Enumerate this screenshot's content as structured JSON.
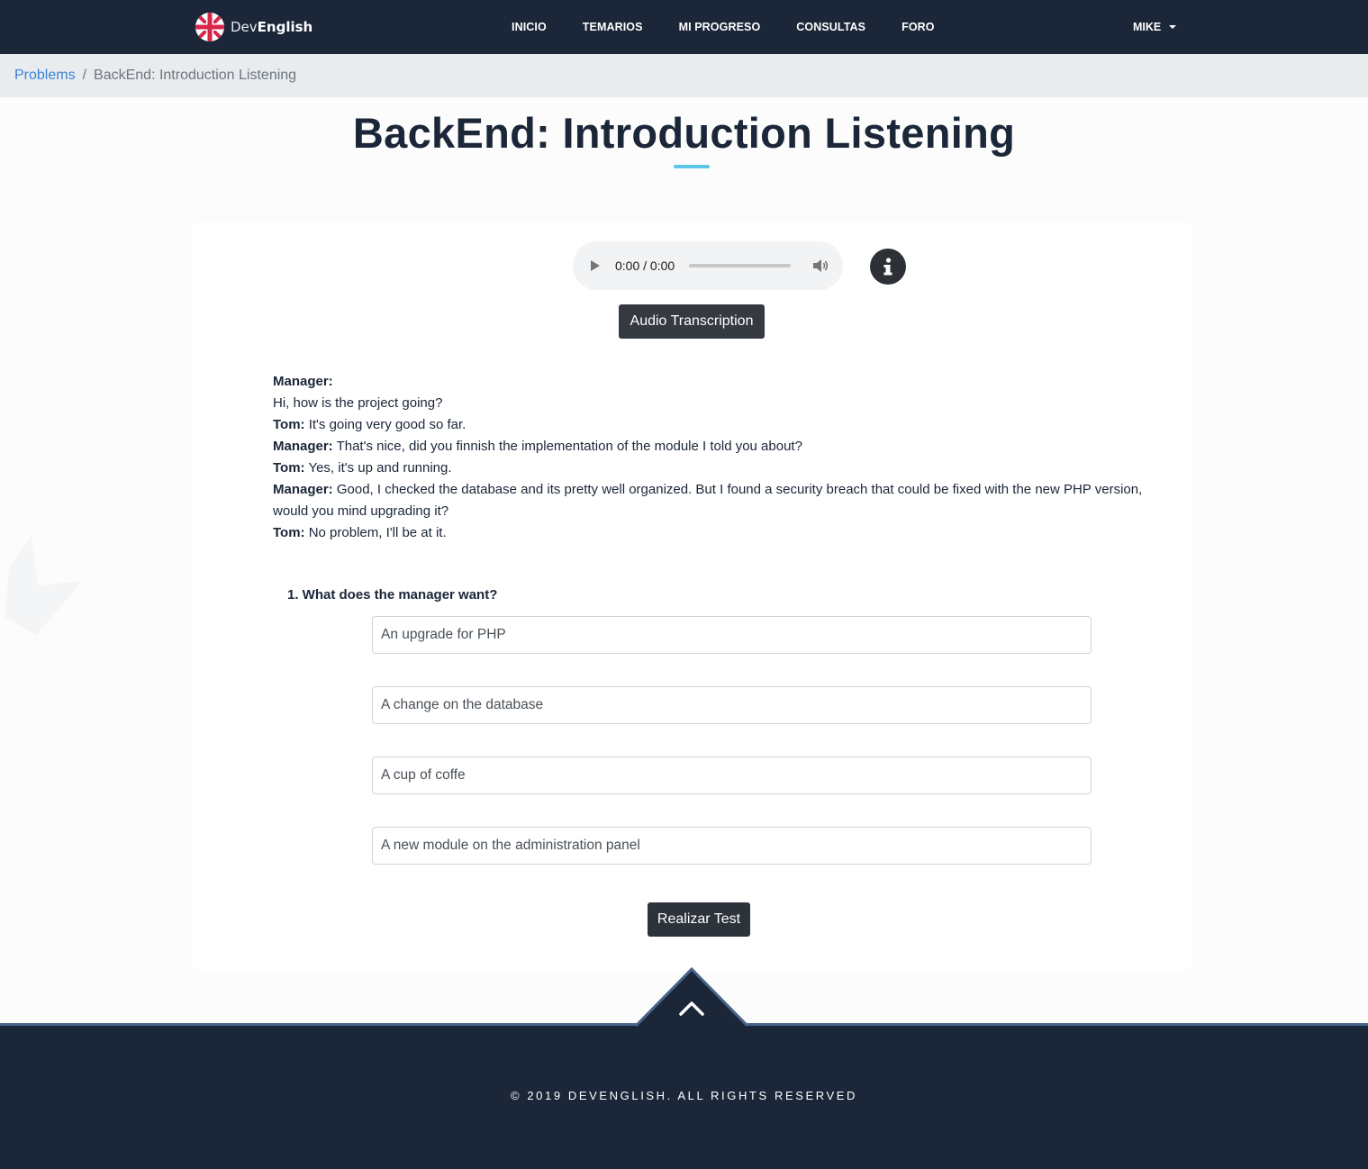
{
  "navbar": {
    "brand_prefix": "Dev",
    "brand_suffix": "English",
    "links": [
      "INICIO",
      "TEMARIOS",
      "MI PROGRESO",
      "CONSULTAS",
      "FORO"
    ],
    "user": "MIKE"
  },
  "breadcrumb": {
    "parent": "Problems",
    "separator": "/",
    "current": "BackEnd: Introduction Listening"
  },
  "page_title": "BackEnd: Introduction Listening",
  "audio": {
    "time": "0:00 / 0:00",
    "progress": 0
  },
  "transcription_button": "Audio Transcription",
  "transcript": [
    {
      "speaker": "Manager:",
      "text": ""
    },
    {
      "speaker": "",
      "text": "Hi, how is the project going?"
    },
    {
      "speaker": "Tom:",
      "text": " It's going very good so far."
    },
    {
      "speaker": "Manager:",
      "text": " That's nice, did you finnish the implementation of the module I told you about?"
    },
    {
      "speaker": "Tom:",
      "text": " Yes, it's up and running."
    },
    {
      "speaker": "Manager:",
      "text": " Good, I checked the database and its pretty well organized. But I found a security breach that could be fixed with the new PHP version, would you mind upgrading it?"
    },
    {
      "speaker": "Tom:",
      "text": " No problem, I'll be at it."
    }
  ],
  "question": {
    "label": "1. What does the manager want?",
    "options": [
      "An upgrade for PHP",
      "A change on the database",
      "A cup of coffe",
      "A new module on the administration panel"
    ]
  },
  "submit_button": "Realizar Test",
  "footer": {
    "copyright": "© 2019 DEVENGLISH. ALL RIGHTS RESERVED"
  },
  "colors": {
    "navbar": "#1b2638",
    "accent": "#5bc6e6",
    "link": "#3b82d8",
    "button": "#343a40"
  },
  "icons": [
    "uk-flag-icon",
    "caret-down-icon",
    "play-icon",
    "volume-icon",
    "info-icon",
    "chevron-up-icon"
  ]
}
